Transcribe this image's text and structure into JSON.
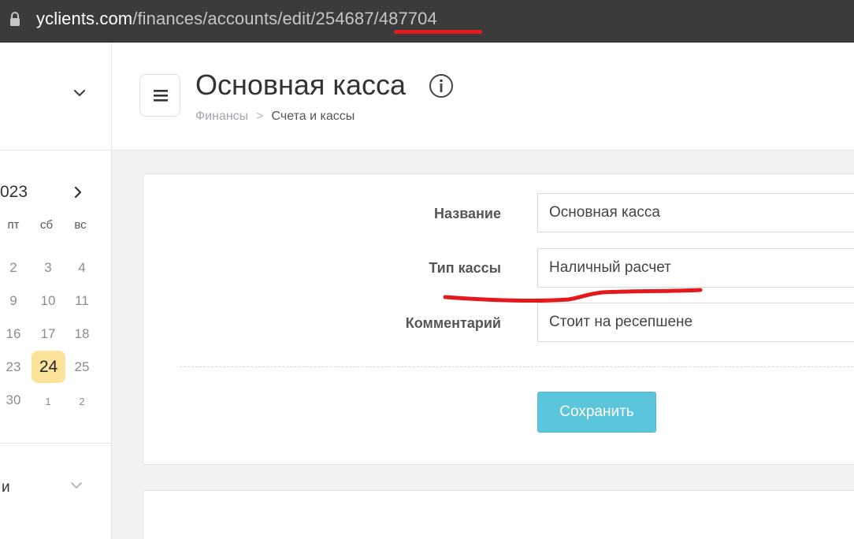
{
  "browser": {
    "url_host": "yclients.com",
    "url_path": "/finances/accounts/edit/254687/487704"
  },
  "sidebar": {
    "calendar": {
      "year_fragment": "023",
      "weekdays": [
        "пт",
        "сб",
        "вс"
      ],
      "weeks": [
        [
          "2",
          "3",
          "4"
        ],
        [
          "9",
          "10",
          "11"
        ],
        [
          "16",
          "17",
          "18"
        ],
        [
          "23",
          "24",
          "25"
        ],
        [
          "30",
          "1",
          "2"
        ]
      ],
      "today": "24"
    },
    "bottom_item_fragment": "и"
  },
  "header": {
    "title": "Основная касса",
    "breadcrumb_root": "Финансы",
    "breadcrumb_separator": ">",
    "breadcrumb_current": "Счета и кассы"
  },
  "form": {
    "fields": [
      {
        "label": "Название",
        "value": "Основная касса"
      },
      {
        "label": "Тип кассы",
        "value": "Наличный расчет"
      },
      {
        "label": "Комментарий",
        "value": "Стоит на ресепшене"
      }
    ],
    "save_label": "Сохранить"
  },
  "colors": {
    "accent_button": "#5bc5dc",
    "today_highlight": "#fbe39a",
    "annotation_red": "#e3191c"
  }
}
